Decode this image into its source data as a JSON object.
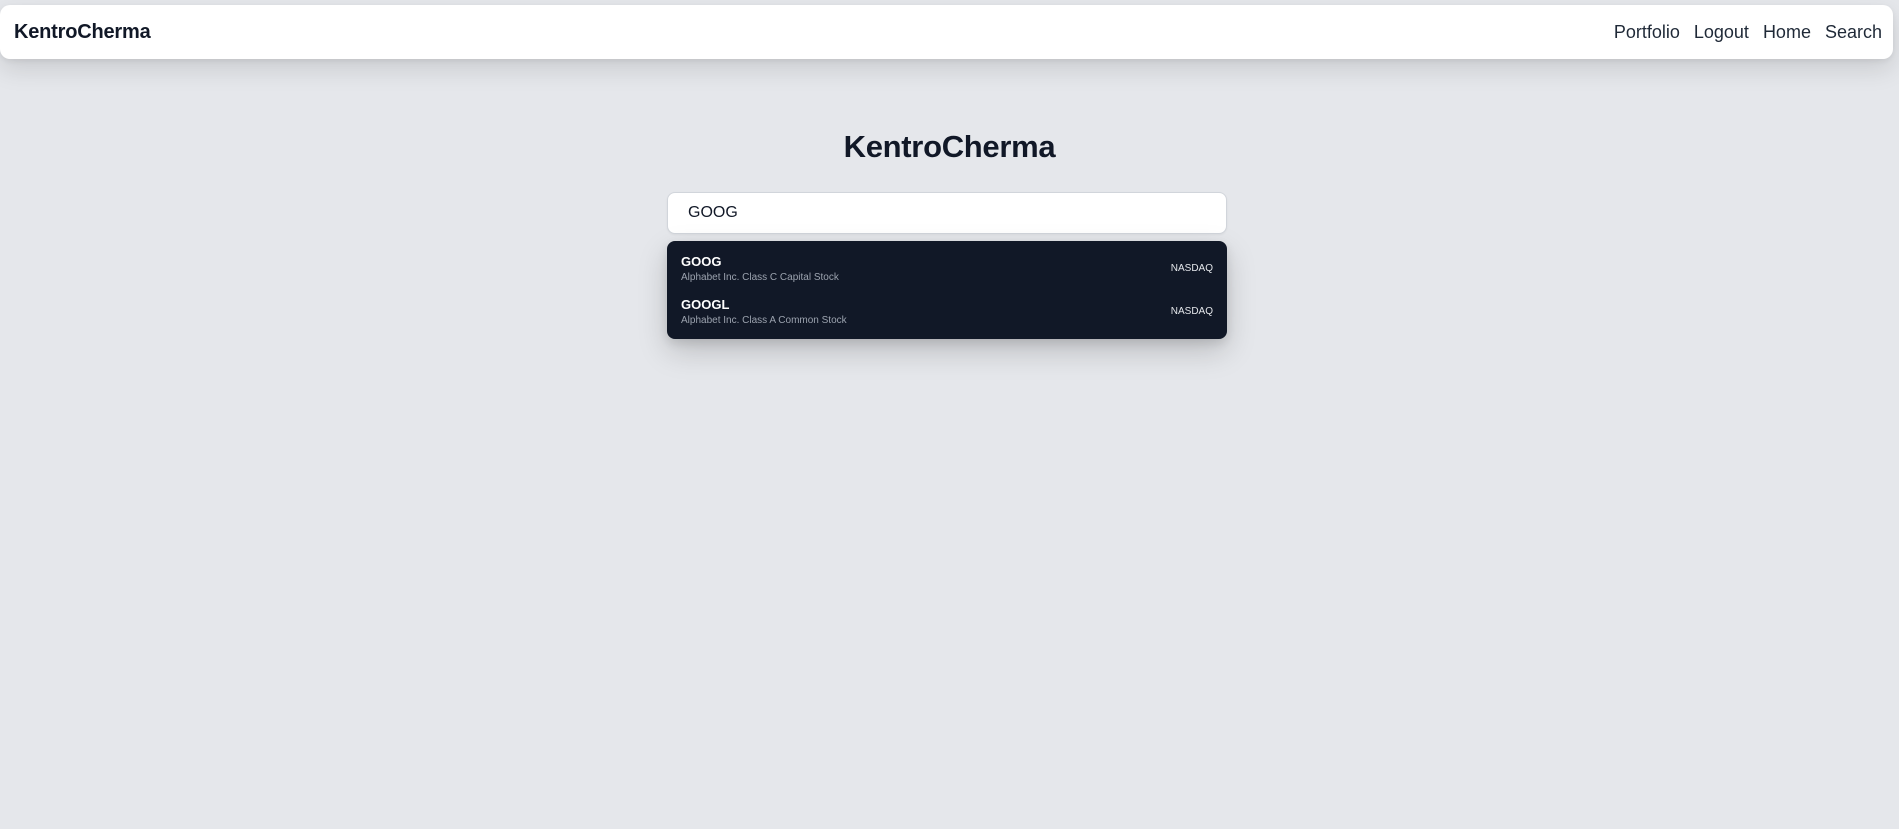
{
  "navbar": {
    "brand": "KentroCherma",
    "links": [
      {
        "label": "Portfolio"
      },
      {
        "label": "Logout"
      },
      {
        "label": "Home"
      },
      {
        "label": "Search"
      }
    ]
  },
  "main": {
    "title": "KentroCherma",
    "search": {
      "value": "GOOG",
      "placeholder": ""
    },
    "results": [
      {
        "ticker": "GOOG",
        "name": "Alphabet Inc. Class C Capital Stock",
        "exchange": "NASDAQ"
      },
      {
        "ticker": "GOOGL",
        "name": "Alphabet Inc. Class A Common Stock",
        "exchange": "NASDAQ"
      }
    ]
  },
  "colors": {
    "background": "#e5e7eb",
    "navbar": "#ffffff",
    "dropdown": "#111827",
    "text": "#111827"
  }
}
